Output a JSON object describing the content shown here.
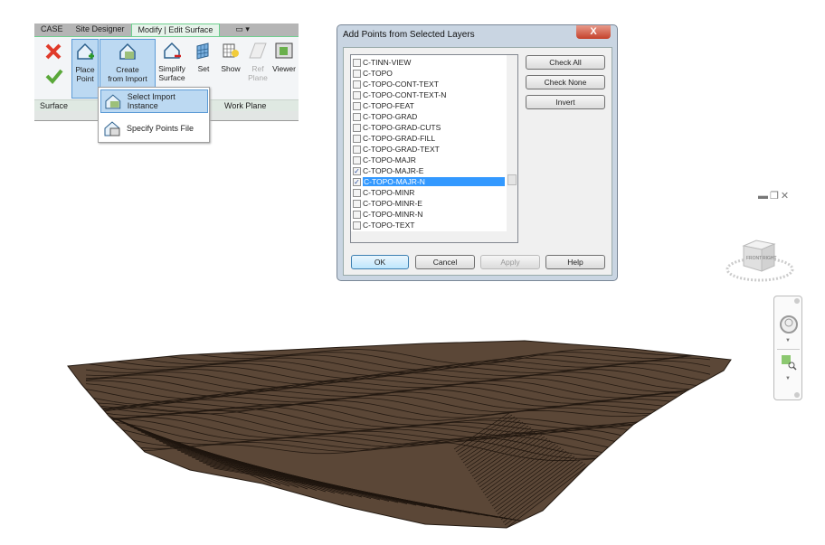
{
  "ribbon": {
    "tabs": [
      {
        "label": "CASE"
      },
      {
        "label": "Site Designer"
      },
      {
        "label": "Modify | Edit Surface",
        "active": true
      },
      {
        "label": "▭ ▾"
      }
    ],
    "tools": [
      {
        "label1": "Place",
        "label2": "Point",
        "icon": "place-point-icon",
        "selected": true
      },
      {
        "label1": "Create",
        "label2": "from Import",
        "icon": "create-from-import-icon",
        "selected": true
      },
      {
        "label1": "Simplify",
        "label2": "Surface",
        "icon": "simplify-surface-icon"
      },
      {
        "label1": "Set",
        "label2": "",
        "icon": "set-workplane-icon"
      },
      {
        "label1": "Show",
        "label2": "",
        "icon": "show-workplane-icon"
      },
      {
        "label1": "Ref",
        "label2": "Plane",
        "icon": "ref-plane-icon",
        "disabled": true
      },
      {
        "label1": "Viewer",
        "label2": "",
        "icon": "viewer-icon"
      }
    ],
    "panels": {
      "surface": "Surface",
      "work_plane": "Work Plane"
    },
    "dropdown": [
      {
        "label": "Select Import Instance",
        "highlighted": true
      },
      {
        "label": "Specify Points File"
      }
    ]
  },
  "dialog": {
    "title": "Add Points from Selected Layers",
    "close": "X",
    "layers": [
      {
        "name": "C-TINN-VIEW",
        "checked": false
      },
      {
        "name": "C-TOPO",
        "checked": false
      },
      {
        "name": "C-TOPO-CONT-TEXT",
        "checked": false
      },
      {
        "name": "C-TOPO-CONT-TEXT-N",
        "checked": false
      },
      {
        "name": "C-TOPO-FEAT",
        "checked": false
      },
      {
        "name": "C-TOPO-GRAD",
        "checked": false
      },
      {
        "name": "C-TOPO-GRAD-CUTS",
        "checked": false
      },
      {
        "name": "C-TOPO-GRAD-FILL",
        "checked": false
      },
      {
        "name": "C-TOPO-GRAD-TEXT",
        "checked": false
      },
      {
        "name": "C-TOPO-MAJR",
        "checked": false
      },
      {
        "name": "C-TOPO-MAJR-E",
        "checked": true
      },
      {
        "name": "C-TOPO-MAJR-N",
        "checked": true,
        "selected": true
      },
      {
        "name": "C-TOPO-MINR",
        "checked": false
      },
      {
        "name": "C-TOPO-MINR-E",
        "checked": false
      },
      {
        "name": "C-TOPO-MINR-N",
        "checked": false
      },
      {
        "name": "C-TOPO-TEXT",
        "checked": false
      }
    ],
    "buttons": {
      "check_all": "Check All",
      "check_none": "Check None",
      "invert": "Invert",
      "ok": "OK",
      "cancel": "Cancel",
      "apply": "Apply",
      "help": "Help"
    }
  },
  "viewcube": {
    "faces": [
      "FRONT",
      "RIGHT"
    ]
  },
  "colors": {
    "terrain": "#5b4737",
    "contour": "#241a12",
    "selection": "#3399ff",
    "ribbon_accent": "#6fcf8f"
  }
}
